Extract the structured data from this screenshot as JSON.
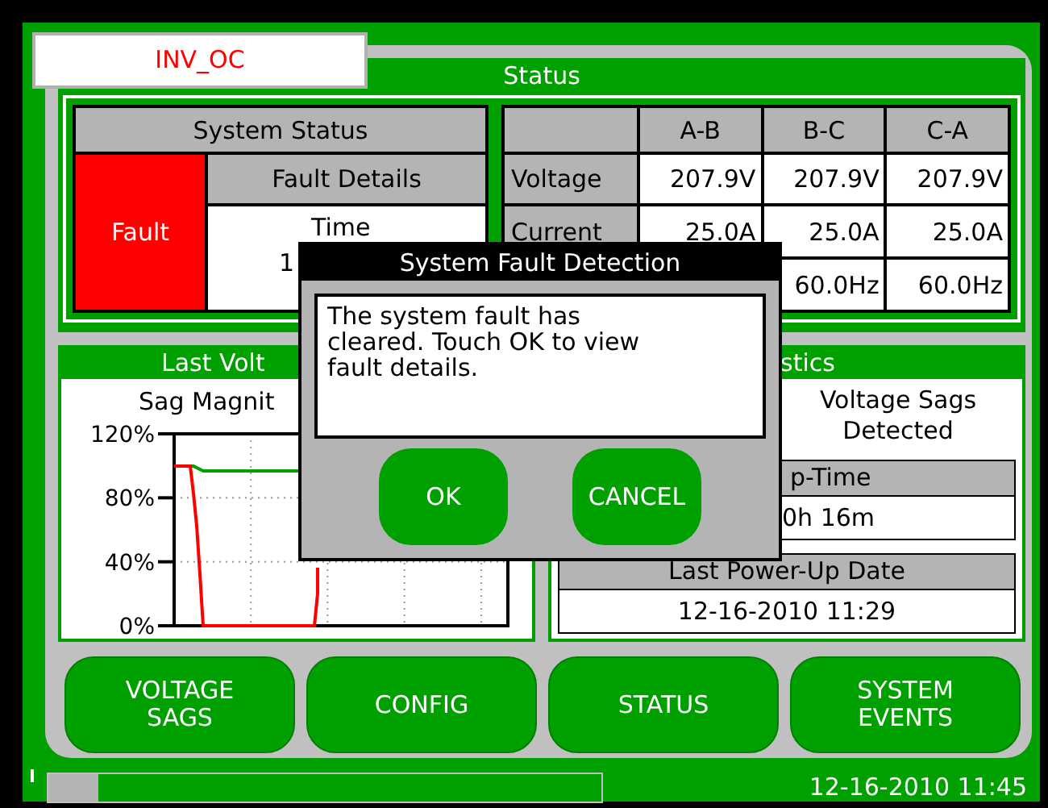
{
  "alarm_tag": "INV_OC",
  "title": "Status",
  "system_status": {
    "header": "System Status",
    "fault": true,
    "state_label": "Fault",
    "details_header": "Fault Details",
    "details_lines": [
      "Time",
      "1"
    ]
  },
  "readings": {
    "columns": [
      "A-B",
      "B-C",
      "C-A"
    ],
    "rows": [
      {
        "label": "Voltage",
        "values": [
          "207.9V",
          "207.9V",
          "207.9V"
        ]
      },
      {
        "label": "Current",
        "values": [
          "25.0A",
          "25.0A",
          "25.0A"
        ]
      },
      {
        "values": [
          "60.0Hz",
          "60.0Hz"
        ]
      }
    ]
  },
  "last_sag": {
    "title": "Last Volt",
    "chart_label": "Sag Magnit",
    "axis_labels": [
      "120%",
      "80%",
      "40%",
      "0%"
    ]
  },
  "statistics": {
    "title": "stics",
    "sags_text": "Voltage Sags\nDetected",
    "items": [
      {
        "header": "p-Time",
        "value": "0h 16m"
      },
      {
        "header": "Last Power-Up Date",
        "value": "12-16-2010 11:29"
      }
    ]
  },
  "nav_buttons": [
    "VOLTAGE\nSAGS",
    "CONFIG",
    "STATUS",
    "SYSTEM\nEVENTS"
  ],
  "status_bar": {
    "progress": {
      "level": 0.09
    },
    "datetime": "12-16-2010 11:45"
  },
  "dialog": {
    "title": "System Fault Detection",
    "message": "The system fault has\ncleared. Touch OK to view\nfault details.",
    "buttons": [
      "OK",
      "CANCEL"
    ]
  }
}
